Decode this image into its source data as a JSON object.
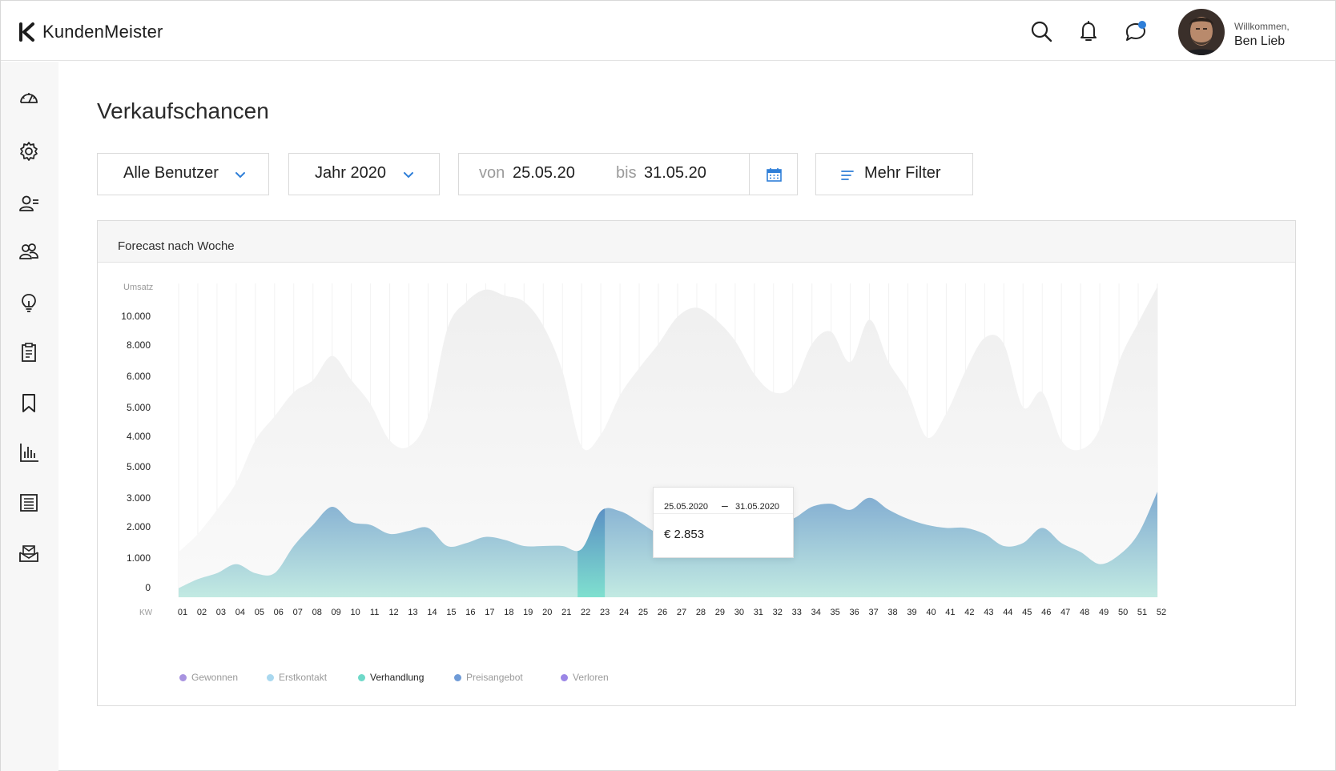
{
  "app": {
    "name": "KundenMeister"
  },
  "header": {
    "welcome": "Willkommen,",
    "user": "Ben Lieb"
  },
  "sidebar": {
    "items": [
      "dashboard-icon",
      "settings-icon",
      "contacts-icon",
      "team-icon",
      "ideas-icon",
      "clipboard-icon",
      "bookmark-icon",
      "reports-icon",
      "list-icon",
      "mail-icon"
    ]
  },
  "page": {
    "title": "Verkaufschancen"
  },
  "filters": {
    "users": "Alle Benutzer",
    "year": "Jahr 2020",
    "from_label": "von",
    "from": "25.05.20",
    "to_label": "bis",
    "to": "31.05.20",
    "more": "Mehr Filter"
  },
  "colors": {
    "accent": "#2f7fd8",
    "area_top": "#7aa7cf",
    "area_bottom": "#bfe9e1",
    "highlight": "#5b97c8",
    "background_area": "#f2f2f2"
  },
  "chart_data": {
    "type": "area",
    "title": "Forecast nach Woche",
    "ylabel": "Umsatz",
    "xlabel": "KW",
    "y_tick_labels": [
      "0",
      "1.000",
      "2.000",
      "3.000",
      "5.000",
      "4.000",
      "5.000",
      "6.000",
      "8.000",
      "10.000"
    ],
    "x": [
      "01",
      "02",
      "03",
      "04",
      "05",
      "06",
      "07",
      "08",
      "09",
      "10",
      "11",
      "12",
      "13",
      "14",
      "15",
      "16",
      "17",
      "18",
      "19",
      "20",
      "21",
      "22",
      "23",
      "24",
      "25",
      "26",
      "27",
      "28",
      "29",
      "30",
      "31",
      "32",
      "33",
      "34",
      "35",
      "36",
      "37",
      "38",
      "39",
      "40",
      "41",
      "42",
      "43",
      "44",
      "45",
      "46",
      "47",
      "48",
      "49",
      "50",
      "51",
      "52"
    ],
    "series": [
      {
        "values": [
          1500,
          2100,
          2900,
          3800,
          5200,
          6000,
          6800,
          7200,
          8000,
          7200,
          6400,
          5200,
          5000,
          6000,
          8900,
          9800,
          10200,
          10000,
          9800,
          9000,
          7500,
          5000,
          5400,
          6700,
          7600,
          8400,
          9300,
          9600,
          9200,
          8500,
          7400,
          6800,
          7000,
          8400,
          8800,
          7800,
          9200,
          7800,
          6800,
          5300,
          6100,
          7500,
          8600,
          8400,
          6300,
          6800,
          5200,
          4900,
          5600,
          7800,
          9100,
          10300
        ]
      },
      {
        "values": [
          300,
          600,
          800,
          1100,
          800,
          800,
          1700,
          2400,
          3000,
          2500,
          2400,
          2100,
          2200,
          2300,
          1700,
          1800,
          2000,
          1900,
          1700,
          1700,
          1700,
          1600,
          2853,
          2853,
          2500,
          2100,
          1900,
          1800,
          1800,
          2000,
          2400,
          2500,
          2600,
          3000,
          3100,
          2900,
          3300,
          2900,
          2600,
          2400,
          2300,
          2300,
          2100,
          1700,
          1800,
          2300,
          1800,
          1500,
          1100,
          1400,
          2100,
          3500
        ]
      }
    ],
    "highlight": {
      "week": "22",
      "from": "25.05.2020",
      "to": "31.05.2020",
      "value": "€ 2.853"
    },
    "legend": [
      {
        "name": "Gewonnen",
        "color": "#a893e0",
        "active": false
      },
      {
        "name": "Erstkontakt",
        "color": "#a9d8ef",
        "active": false
      },
      {
        "name": "Verhandlung",
        "color": "#6fd9c9",
        "active": true
      },
      {
        "name": "Preisangebot",
        "color": "#6f9bd7",
        "active": false
      },
      {
        "name": "Verloren",
        "color": "#9b86e6",
        "active": false
      }
    ]
  }
}
